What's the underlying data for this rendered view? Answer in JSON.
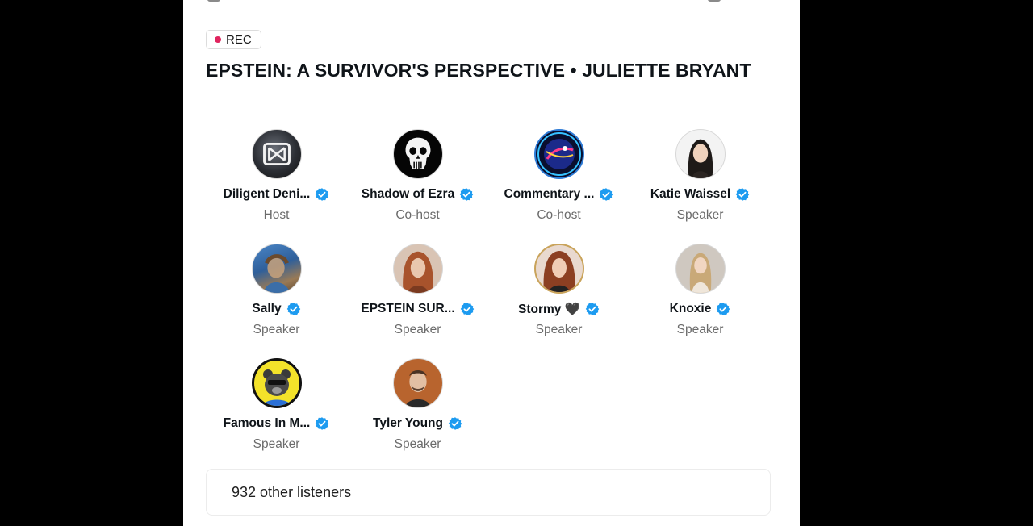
{
  "space": {
    "rec_label": "REC",
    "title": "EPSTEIN: A SURVIVOR'S PERSPECTIVE • JULIETTE BRYANT"
  },
  "participants": [
    {
      "name": "Diligent Deni...",
      "role": "Host",
      "verified": true,
      "avatar": "double-d-logo-icon"
    },
    {
      "name": "Shadow of Ezra",
      "role": "Co-host",
      "verified": true,
      "avatar": "skull-icon"
    },
    {
      "name": "Commentary ...",
      "role": "Co-host",
      "verified": true,
      "avatar": "xspaces-badge-icon"
    },
    {
      "name": "Katie Waissel",
      "role": "Speaker",
      "verified": true,
      "avatar": "portrait-photo"
    },
    {
      "name": "Sally",
      "role": "Speaker",
      "verified": true,
      "avatar": "painting-photo"
    },
    {
      "name": "EPSTEIN SUR...",
      "role": "Speaker",
      "verified": true,
      "avatar": "portrait-photo"
    },
    {
      "name": "Stormy 🖤",
      "role": "Speaker",
      "verified": true,
      "avatar": "portrait-photo"
    },
    {
      "name": "Knoxie",
      "role": "Speaker",
      "verified": true,
      "avatar": "portrait-photo"
    },
    {
      "name": "Famous In M...",
      "role": "Speaker",
      "verified": true,
      "avatar": "cartoon-bear-icon"
    },
    {
      "name": "Tyler Young",
      "role": "Speaker",
      "verified": true,
      "avatar": "portrait-photo"
    }
  ],
  "listeners": {
    "label": "932 other listeners"
  },
  "colors": {
    "verified_blue": "#1d9bf0",
    "rec_red": "#e0245e",
    "role_gray": "#6b6b6b"
  }
}
